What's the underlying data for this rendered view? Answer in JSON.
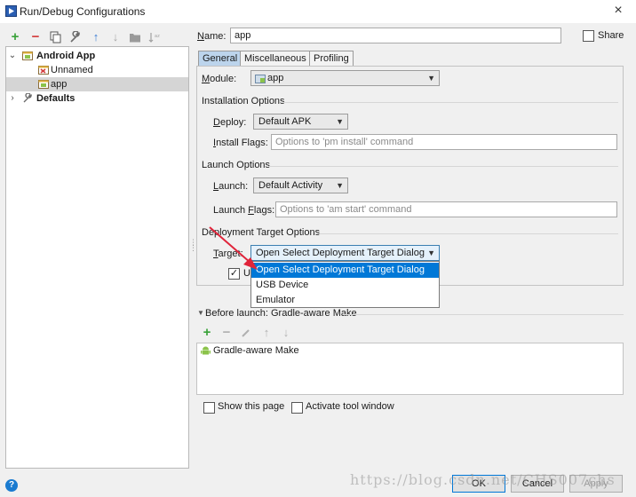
{
  "window": {
    "title": "Run/Debug Configurations",
    "icon": "run-debug-icon",
    "close_glyph": "×"
  },
  "toolbar": {
    "add": "+",
    "remove": "−",
    "copy": "copy-icon",
    "edit_defaults": "wrench-icon",
    "move_up": "↑",
    "move_down": "↓",
    "folder": "folder-icon",
    "sort": "sort-icon"
  },
  "tree": {
    "items": [
      {
        "label": "Android App",
        "level": 0,
        "expanded": true,
        "bold": true
      },
      {
        "label": "Unnamed",
        "level": 1
      },
      {
        "label": "app",
        "level": 1,
        "selected": true
      },
      {
        "label": "Defaults",
        "level": 0,
        "expanded": false,
        "bold": true
      }
    ]
  },
  "name": {
    "label": "Name:",
    "value": "app"
  },
  "share": {
    "label": "Share",
    "checked": false
  },
  "tabs": [
    {
      "label": "General",
      "active": true
    },
    {
      "label": "Miscellaneous"
    },
    {
      "label": "Profiling"
    }
  ],
  "general": {
    "module_label": "Module:",
    "module_value": "app",
    "installation_title": "Installation Options",
    "deploy_label": "Deploy:",
    "deploy_value": "Default APK",
    "install_flags_label": "Install Flags:",
    "install_flags_placeholder": "Options to 'pm install' command",
    "launch_title": "Launch Options",
    "launch_label": "Launch:",
    "launch_value": "Default Activity",
    "launch_flags_label": "Launch Flags:",
    "launch_flags_placeholder": "Options to 'am start' command",
    "deployment_title": "Deployment Target Options",
    "target_label": "Target:",
    "target_value": "Open Select Deployment Target Dialog",
    "use_checkbox_label": "U",
    "use_checkbox_checked": true
  },
  "target_dropdown": {
    "options": [
      "Open Select Deployment Target Dialog",
      "USB Device",
      "Emulator"
    ],
    "highlighted_index": 0
  },
  "before_launch": {
    "title": "Before launch: Gradle-aware Make",
    "tools": {
      "add": "+",
      "remove": "−",
      "edit": "pencil-icon",
      "up": "↑",
      "down": "↓"
    },
    "items": [
      "Gradle-aware Make"
    ]
  },
  "options": {
    "show_page_label": "Show this page",
    "show_page_checked": false,
    "activate_tool_label": "Activate tool window",
    "activate_tool_checked": false
  },
  "buttons": {
    "ok": "OK",
    "cancel": "Cancel",
    "apply": "Apply"
  },
  "help_glyph": "?",
  "watermark": "https://blog.csdn.net/CHS007chs",
  "colors": {
    "selection": "#0078d7",
    "active_tab": "#bcd4ec",
    "annotation_arrow": "#e0243a",
    "android_green": "#8bc34a"
  }
}
